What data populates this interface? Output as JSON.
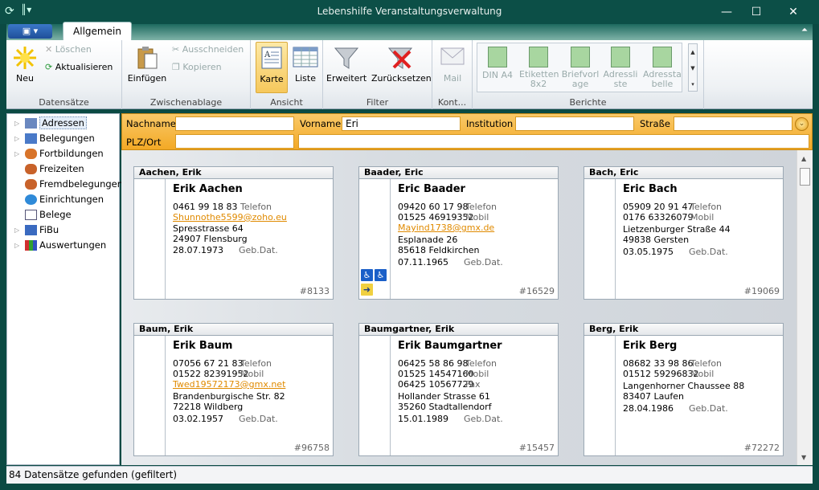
{
  "window": {
    "title": "Lebenshilfe Veranstaltungsverwaltung",
    "minimize": "—",
    "maximize": "☐",
    "close": "✕"
  },
  "ribbon": {
    "tab": "Allgemein",
    "groups": {
      "datensaetze": {
        "label": "Datensätze",
        "neu": "Neu",
        "loeschen": "Löschen",
        "aktualisieren": "Aktualisieren"
      },
      "zwischenablage": {
        "label": "Zwischenablage",
        "einfuegen": "Einfügen",
        "ausschneiden": "Ausschneiden",
        "kopieren": "Kopieren"
      },
      "ansicht": {
        "label": "Ansicht",
        "karte": "Karte",
        "liste": "Liste"
      },
      "filter": {
        "label": "Filter",
        "erweitert": "Erweitert",
        "zuruecksetzen": "Zurücksetzen"
      },
      "kontakt": {
        "label": "Kont...",
        "mail": "Mail"
      },
      "berichte": {
        "label": "Berichte",
        "din_a4": "DIN A4",
        "etiketten_1": "Etiketten",
        "etiketten_2": "8x2",
        "briefvorlage_1": "Briefvorl",
        "briefvorlage_2": "age",
        "adressliste_1": "Adressli",
        "adressliste_2": "ste",
        "adressbelle_1": "Adressta",
        "adressbelle_2": "belle"
      }
    }
  },
  "sidebar": {
    "items": [
      {
        "label": "Adressen",
        "active": true,
        "expander": true
      },
      {
        "label": "Belegungen",
        "expander": true
      },
      {
        "label": "Fortbildungen",
        "expander": true
      },
      {
        "label": "Freizeiten",
        "expander": false
      },
      {
        "label": "Fremdbelegungen",
        "expander": false
      },
      {
        "label": "Einrichtungen",
        "expander": false
      },
      {
        "label": "Belege",
        "expander": false
      },
      {
        "label": "FiBu",
        "expander": true
      },
      {
        "label": "Auswertungen",
        "expander": true
      }
    ]
  },
  "filter": {
    "nachname_label": "Nachname",
    "nachname_value": "",
    "vorname_label": "Vorname",
    "vorname_value": "Eri",
    "institution_label": "Institution",
    "institution_value": "",
    "strasse_label": "Straße",
    "strasse_value": "",
    "plzort_label": "PLZ/Ort",
    "plzort_value": "",
    "extra_value": ""
  },
  "cards": [
    {
      "header": "Aachen, Erik",
      "name": "Erik Aachen",
      "phone1": "0461 99 18 83",
      "phone1_type": "Telefon",
      "email": "Shunnothe5599@zoho.eu",
      "street": "Spresstrasse 64",
      "city": "24907 Flensburg",
      "birth": "28.07.1973",
      "birth_label": "Geb.Dat.",
      "id": "#8133"
    },
    {
      "header": "Baader, Eric",
      "name": "Eric Baader",
      "phone1": "09420 60 17 98",
      "phone1_type": "Telefon",
      "phone2": "01525 46919352",
      "phone2_type": "Mobil",
      "email": "Mayind1738@gmx.de",
      "street": "Esplanade 26",
      "city": "85618 Feldkirchen",
      "birth": "07.11.1965",
      "birth_label": "Geb.Dat.",
      "id": "#16529",
      "icons": true
    },
    {
      "header": "Bach, Eric",
      "name": "Eric Bach",
      "phone1": "05909 20 91 47",
      "phone1_type": "Telefon",
      "phone2": "0176 63326079",
      "phone2_type": "Mobil",
      "street": "Lietzenburger Straße 44",
      "city": "49838 Gersten",
      "birth": "03.05.1975",
      "birth_label": "Geb.Dat.",
      "id": "#19069"
    },
    {
      "header": "Baum, Erik",
      "name": "Erik Baum",
      "phone1": "07056 67 21 83",
      "phone1_type": "Telefon",
      "phone2": "01522 82391952",
      "phone2_type": "Mobil",
      "email": "Twed19572173@gmx.net",
      "street": "Brandenburgische Str. 82",
      "city": "72218 Wildberg",
      "birth": "03.02.1957",
      "birth_label": "Geb.Dat.",
      "id": "#96758"
    },
    {
      "header": "Baumgartner, Erik",
      "name": "Erik Baumgartner",
      "phone1": "06425 58 86 98",
      "phone1_type": "Telefon",
      "phone2": "01525 14547160",
      "phone2_type": "Mobil",
      "phone3": "06425 10567729",
      "phone3_type": "Fax",
      "street": "Hollander Strasse 61",
      "city": "35260 Stadtallendorf",
      "birth": "15.01.1989",
      "birth_label": "Geb.Dat.",
      "id": "#15457"
    },
    {
      "header": "Berg, Erik",
      "name": "Erik Berg",
      "phone1": "08682 33 98 86",
      "phone1_type": "Telefon",
      "phone2": "01512 59296832",
      "phone2_type": "Mobil",
      "street": "Langenhorner Chaussee 88",
      "city": "83407 Laufen",
      "birth": "28.04.1986",
      "birth_label": "Geb.Dat.",
      "id": "#72272"
    }
  ],
  "status": "84 Datensätze gefunden (gefiltert)"
}
